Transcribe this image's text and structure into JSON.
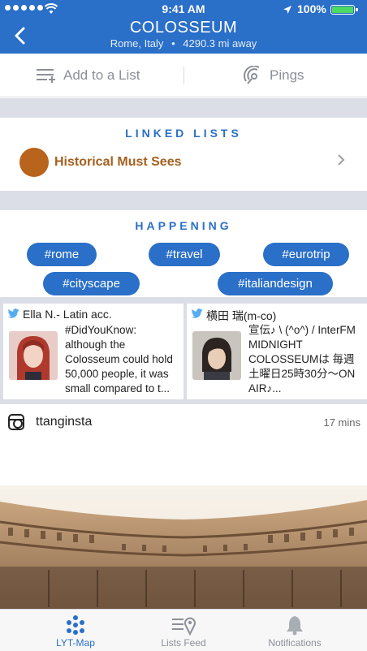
{
  "status_bar": {
    "time": "9:41 AM",
    "battery": "100%"
  },
  "header": {
    "back_icon": "chevron-left-icon",
    "title": "COLOSSEUM",
    "location": "Rome, Italy",
    "separator": "•",
    "distance": "4290.3 mi away"
  },
  "actions": {
    "add_label": "Add to a List",
    "pings_label": "Pings"
  },
  "linked_lists": {
    "title": "LINKED LISTS",
    "items": [
      {
        "label": "Historical Must Sees",
        "color": "#b8641c"
      }
    ]
  },
  "happening": {
    "title": "HAPPENING",
    "tags": [
      "#rome",
      "#travel",
      "#eurotrip",
      "#cityscape",
      "#italiandesign"
    ]
  },
  "tweets": [
    {
      "author": "Ella N.- Latin acc.",
      "text": "#DidYouKnow: although the Colosseum could hold 50,000 people, it was small compared to t..."
    },
    {
      "author": "横田 瑞(m-co)",
      "text": "宣伝♪ \\ (^o^) / InterFM MIDNIGHT COLOSSEUMは 毎週土曜日25時30分〜ON AIR♪..."
    }
  ],
  "instagram": {
    "username": "ttanginsta",
    "time": "17 mins"
  },
  "tabbar": {
    "items": [
      {
        "label": "LYT-Map",
        "active": true
      },
      {
        "label": "Lists Feed",
        "active": false
      },
      {
        "label": "Notifications",
        "active": false
      }
    ]
  },
  "colors": {
    "brand": "#2a6fc8",
    "list_accent": "#a5601f",
    "background_band": "#dcdee7"
  }
}
